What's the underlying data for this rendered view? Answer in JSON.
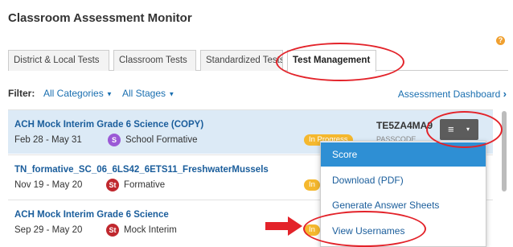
{
  "header": {
    "title": "Classroom Assessment Monitor",
    "help_icon": "?"
  },
  "tabs": [
    {
      "label": "District & Local Tests"
    },
    {
      "label": "Classroom Tests"
    },
    {
      "label": "Standardized Tests"
    },
    {
      "label": "Test Management",
      "active": true
    }
  ],
  "filter": {
    "label": "Filter:",
    "category": "All Categories",
    "stage": "All Stages",
    "dashboard_link": "Assessment Dashboard"
  },
  "rows": [
    {
      "name": "ACH Mock Interim Grade 6 Science (COPY)",
      "dates": "Feb 28 - May 31",
      "badge": "S",
      "type": "School Formative",
      "status": "In Progress",
      "passcode": "TE5ZA4MA9",
      "passcode_label": "PASSCODE"
    },
    {
      "name": "TN_formative_SC_06_6LS42_6ETS11_FreshwaterMussels",
      "dates": "Nov 19 - May 20",
      "badge": "St",
      "type": "Formative",
      "status": "In"
    },
    {
      "name": "ACH Mock Interim Grade 6 Science",
      "dates": "Sep 29 - May 20",
      "badge": "St",
      "type": "Mock Interim",
      "status": "In"
    }
  ],
  "menu": {
    "button_icon": "≡",
    "caret_icon": "▾",
    "items": [
      {
        "label": "Score",
        "active": true
      },
      {
        "label": "Download (PDF)"
      },
      {
        "label": "Generate Answer Sheets"
      },
      {
        "label": "View Usernames"
      }
    ]
  },
  "colors": {
    "accent": "#1a6fb0",
    "active_menu": "#2e8fd4",
    "status": "#f5b82e",
    "annotation": "#e3232a"
  }
}
